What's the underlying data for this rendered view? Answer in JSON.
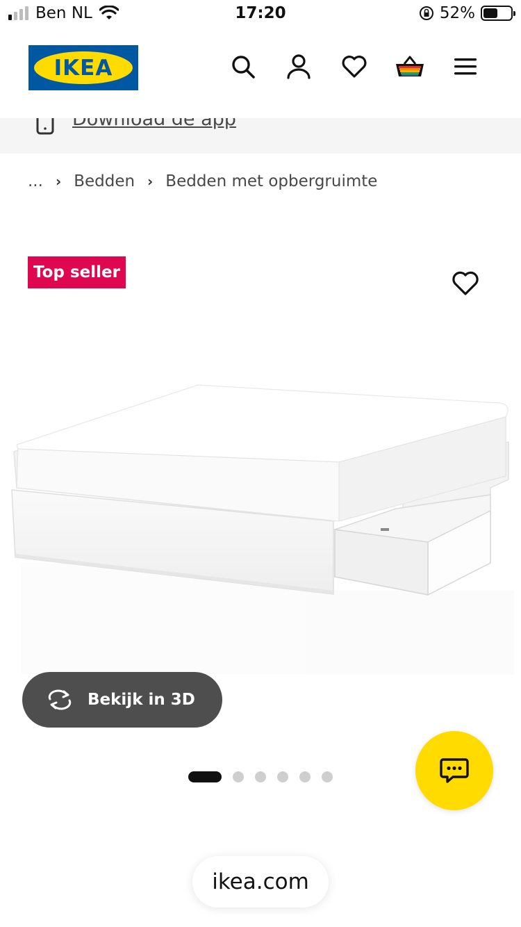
{
  "status_bar": {
    "carrier": "Ben NL",
    "time": "17:20",
    "battery_percent": "52%",
    "battery_level": 0.52,
    "signal_bars_active": 1,
    "signal_bars_total": 4
  },
  "header": {
    "logo_text": "IKEA",
    "icons": [
      "search-icon",
      "account-icon",
      "heart-icon",
      "cart-icon",
      "menu-icon"
    ]
  },
  "app_banner": {
    "link_text": "Download de app"
  },
  "breadcrumb": {
    "items": [
      "...",
      "Bedden",
      "Bedden met opbergruimte"
    ]
  },
  "product": {
    "badge": "Top seller",
    "view_3d_label": "Bekijk in 3D",
    "gallery_count": 6,
    "gallery_active_index": 0
  },
  "url_bar": {
    "domain": "ikea.com"
  },
  "colors": {
    "ikea_blue": "#0058a3",
    "ikea_yellow": "#ffdb00",
    "badge_red": "#e00751",
    "button_dark": "#4e4e4e"
  }
}
